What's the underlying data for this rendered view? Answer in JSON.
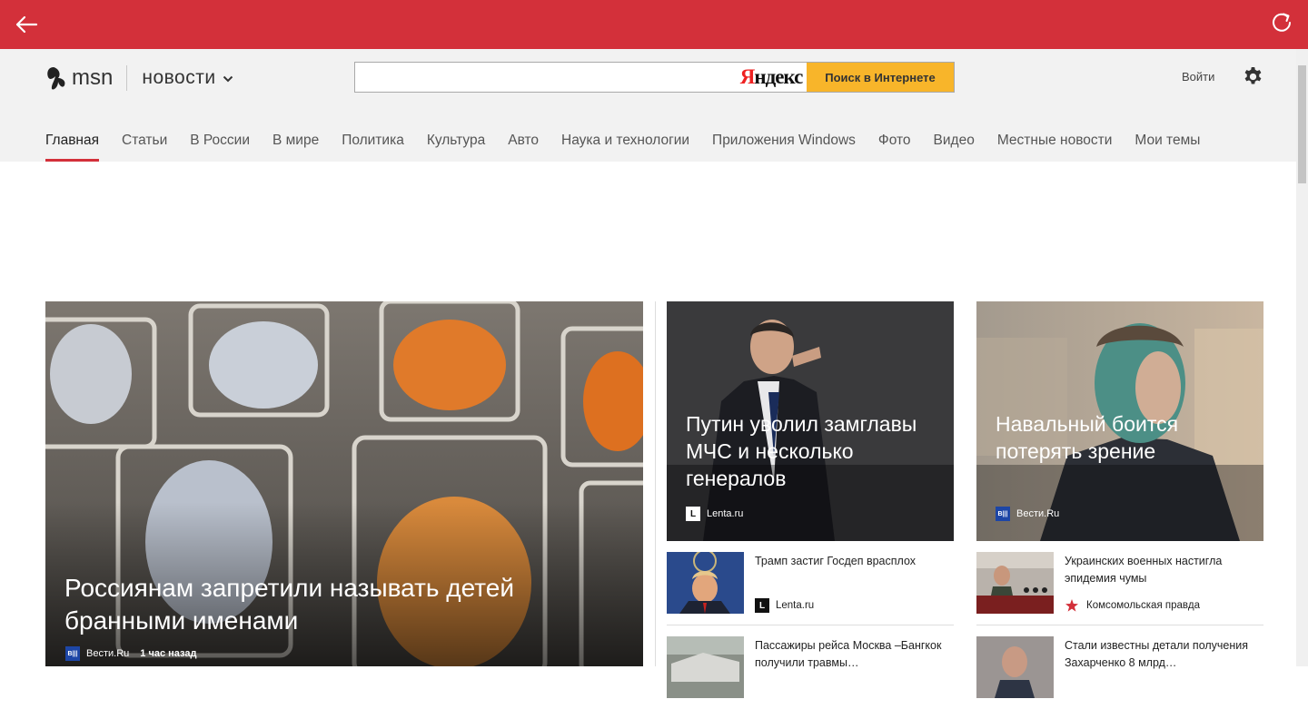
{
  "colors": {
    "accent": "#d3303a",
    "search_button": "#f8b52a"
  },
  "appbar": {
    "back_icon": "arrow-left-icon",
    "refresh_icon": "refresh-icon"
  },
  "header": {
    "logo_text": "msn",
    "section": "новости",
    "search": {
      "value": "",
      "placeholder": "",
      "provider_part1": "Я",
      "provider_part2": "ндекс",
      "button_label": "Поиск в Интернете"
    },
    "signin": "Войти",
    "settings_icon": "gear-icon"
  },
  "nav": {
    "items": [
      "Главная",
      "Статьи",
      "В России",
      "В мире",
      "Политика",
      "Культура",
      "Авто",
      "Наука и технологии",
      "Приложения Windows",
      "Фото",
      "Видео",
      "Местные новости",
      "Мои темы"
    ],
    "active": "Главная"
  },
  "hero": {
    "title": "Россиянам запретили называть детей бранными именами",
    "source": "Вести.Ru",
    "source_badge": "B⃒",
    "time": "1 час назад"
  },
  "featured": [
    {
      "title": "Путин уволил замглавы МЧС и несколько генералов",
      "source": "Lenta.ru",
      "badge": "L"
    },
    {
      "title": "Навальный боится потерять зрение",
      "source": "Вести.Ru",
      "badge": "B"
    }
  ],
  "list_left": [
    {
      "title": "Трамп застиг Госдеп врасплох",
      "source": "Lenta.ru",
      "badge": "L"
    },
    {
      "title": "Пассажиры рейса Москва –Бангкок получили травмы…",
      "source": "",
      "badge": ""
    }
  ],
  "list_right": [
    {
      "title": "Украинских военных настигла эпидемия чумы",
      "source": "Комсомольская правда",
      "badge": "star"
    },
    {
      "title": "Стали известны детали получения Захарченко 8 млрд…",
      "source": "",
      "badge": ""
    }
  ]
}
